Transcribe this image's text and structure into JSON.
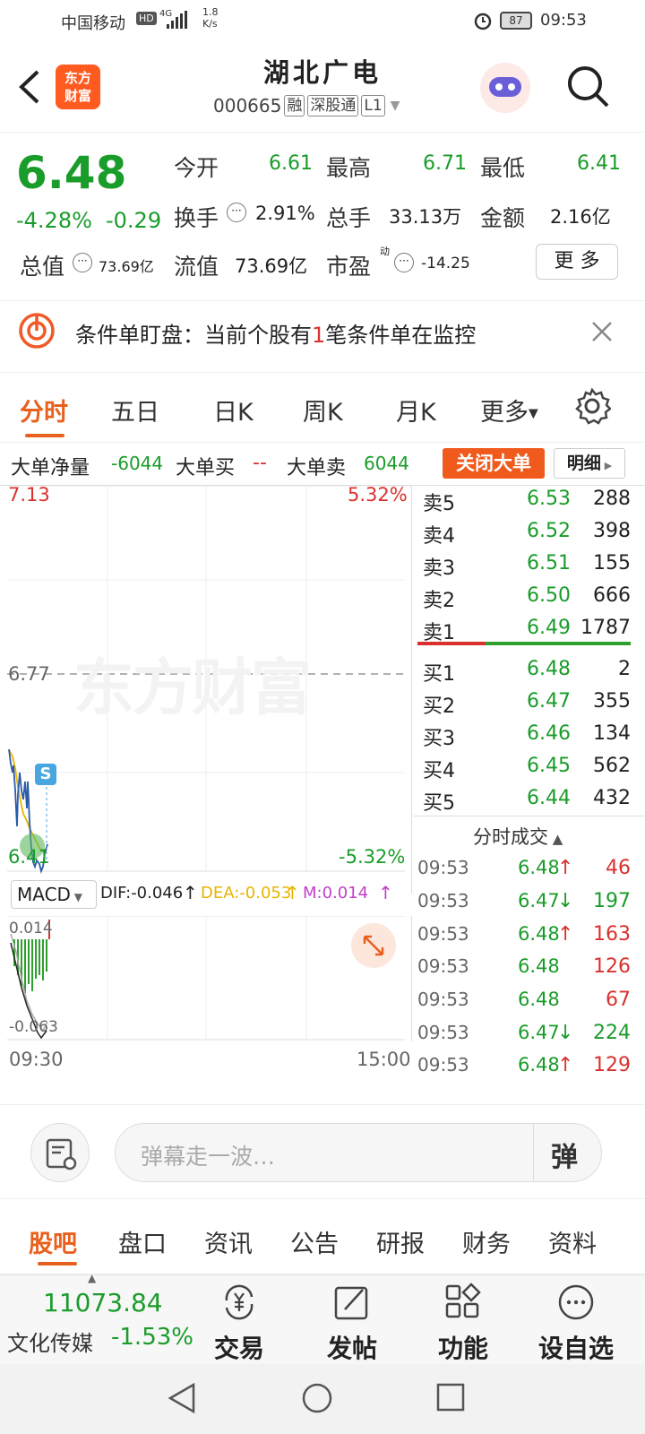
{
  "status_bar": {
    "carrier": "中国移动",
    "network": "4G",
    "speed": "1.8\nK/s",
    "battery": "87",
    "time": "09:53"
  },
  "header": {
    "logo_text": "东方\n财富",
    "stock_name": "湖北广电",
    "stock_code": "000665",
    "tags": [
      "融",
      "深股通",
      "L1"
    ]
  },
  "quote": {
    "price": "6.48",
    "change_pct": "-4.28%",
    "change_amt": "-0.29",
    "open_label": "今开",
    "open": "6.61",
    "high_label": "最高",
    "high": "6.71",
    "low_label": "最低",
    "low": "6.41",
    "turnover_label": "换手",
    "turnover": "2.91%",
    "volume_label": "总手",
    "volume": "33.13万",
    "amount_label": "金额",
    "amount": "2.16亿",
    "mktcap_label": "总值",
    "mktcap": "73.69亿",
    "float_label": "流值",
    "float": "73.69亿",
    "pe_label": "市盈",
    "pe_sup": "动",
    "pe": "-14.25",
    "more_label": "更 多"
  },
  "condition_bar": {
    "prefix": "条件单盯盘：当前个股有",
    "count": "1",
    "suffix": "笔条件单在监控"
  },
  "tabs": [
    "分时",
    "五日",
    "日K",
    "周K",
    "月K",
    "更多"
  ],
  "big_order": {
    "net_label": "大单净量",
    "net_value": "-6044",
    "buy_label": "大单买",
    "buy_value": "--",
    "sell_label": "大单卖",
    "sell_value": "6044",
    "close_button": "关闭大单",
    "detail_button": "明细"
  },
  "chart": {
    "top_price": "7.13",
    "top_pct": "5.32%",
    "mid_price": "6.77",
    "bottom_price": "6.41",
    "bottom_pct": "-5.32%",
    "watermark": "东方财富",
    "marker": "S",
    "start_time": "09:30",
    "end_time": "15:00"
  },
  "macd": {
    "selector": "MACD",
    "dif": "DIF:-0.046",
    "dea": "DEA:-0.053",
    "m": "M:0.014",
    "top": "0.014",
    "bottom": "-0.063"
  },
  "asks": [
    {
      "label": "卖5",
      "price": "6.53",
      "vol": "288"
    },
    {
      "label": "卖4",
      "price": "6.52",
      "vol": "398"
    },
    {
      "label": "卖3",
      "price": "6.51",
      "vol": "155"
    },
    {
      "label": "卖2",
      "price": "6.50",
      "vol": "666"
    },
    {
      "label": "卖1",
      "price": "6.49",
      "vol": "1787"
    }
  ],
  "bids": [
    {
      "label": "买1",
      "price": "6.48",
      "vol": "2"
    },
    {
      "label": "买2",
      "price": "6.47",
      "vol": "355"
    },
    {
      "label": "买3",
      "price": "6.46",
      "vol": "134"
    },
    {
      "label": "买4",
      "price": "6.45",
      "vol": "562"
    },
    {
      "label": "买5",
      "price": "6.44",
      "vol": "432"
    }
  ],
  "trades_title": "分时成交",
  "trades": [
    {
      "time": "09:53",
      "price": "6.48",
      "dir": "up",
      "vol": "46"
    },
    {
      "time": "09:53",
      "price": "6.47",
      "dir": "down",
      "vol": "197"
    },
    {
      "time": "09:53",
      "price": "6.48",
      "dir": "up",
      "vol": "163"
    },
    {
      "time": "09:53",
      "price": "6.48",
      "dir": "none",
      "vol": "126"
    },
    {
      "time": "09:53",
      "price": "6.48",
      "dir": "none",
      "vol": "67"
    },
    {
      "time": "09:53",
      "price": "6.47",
      "dir": "down",
      "vol": "224"
    },
    {
      "time": "09:53",
      "price": "6.48",
      "dir": "up",
      "vol": "129"
    }
  ],
  "input_bar": {
    "placeholder": "弹幕走一波…",
    "send_icon_label": "弹"
  },
  "sub_tabs": [
    "股吧",
    "盘口",
    "资讯",
    "公告",
    "研报",
    "财务",
    "资料"
  ],
  "toolbar": {
    "index_value": "11073.84",
    "index_name": "文化传媒",
    "index_change": "-1.53%",
    "trade": "交易",
    "post": "发帖",
    "function": "功能",
    "watchlist": "设自选"
  },
  "colors": {
    "accent": "#ff5a1f",
    "up": "#d9322e",
    "down": "#1a9c2a"
  }
}
